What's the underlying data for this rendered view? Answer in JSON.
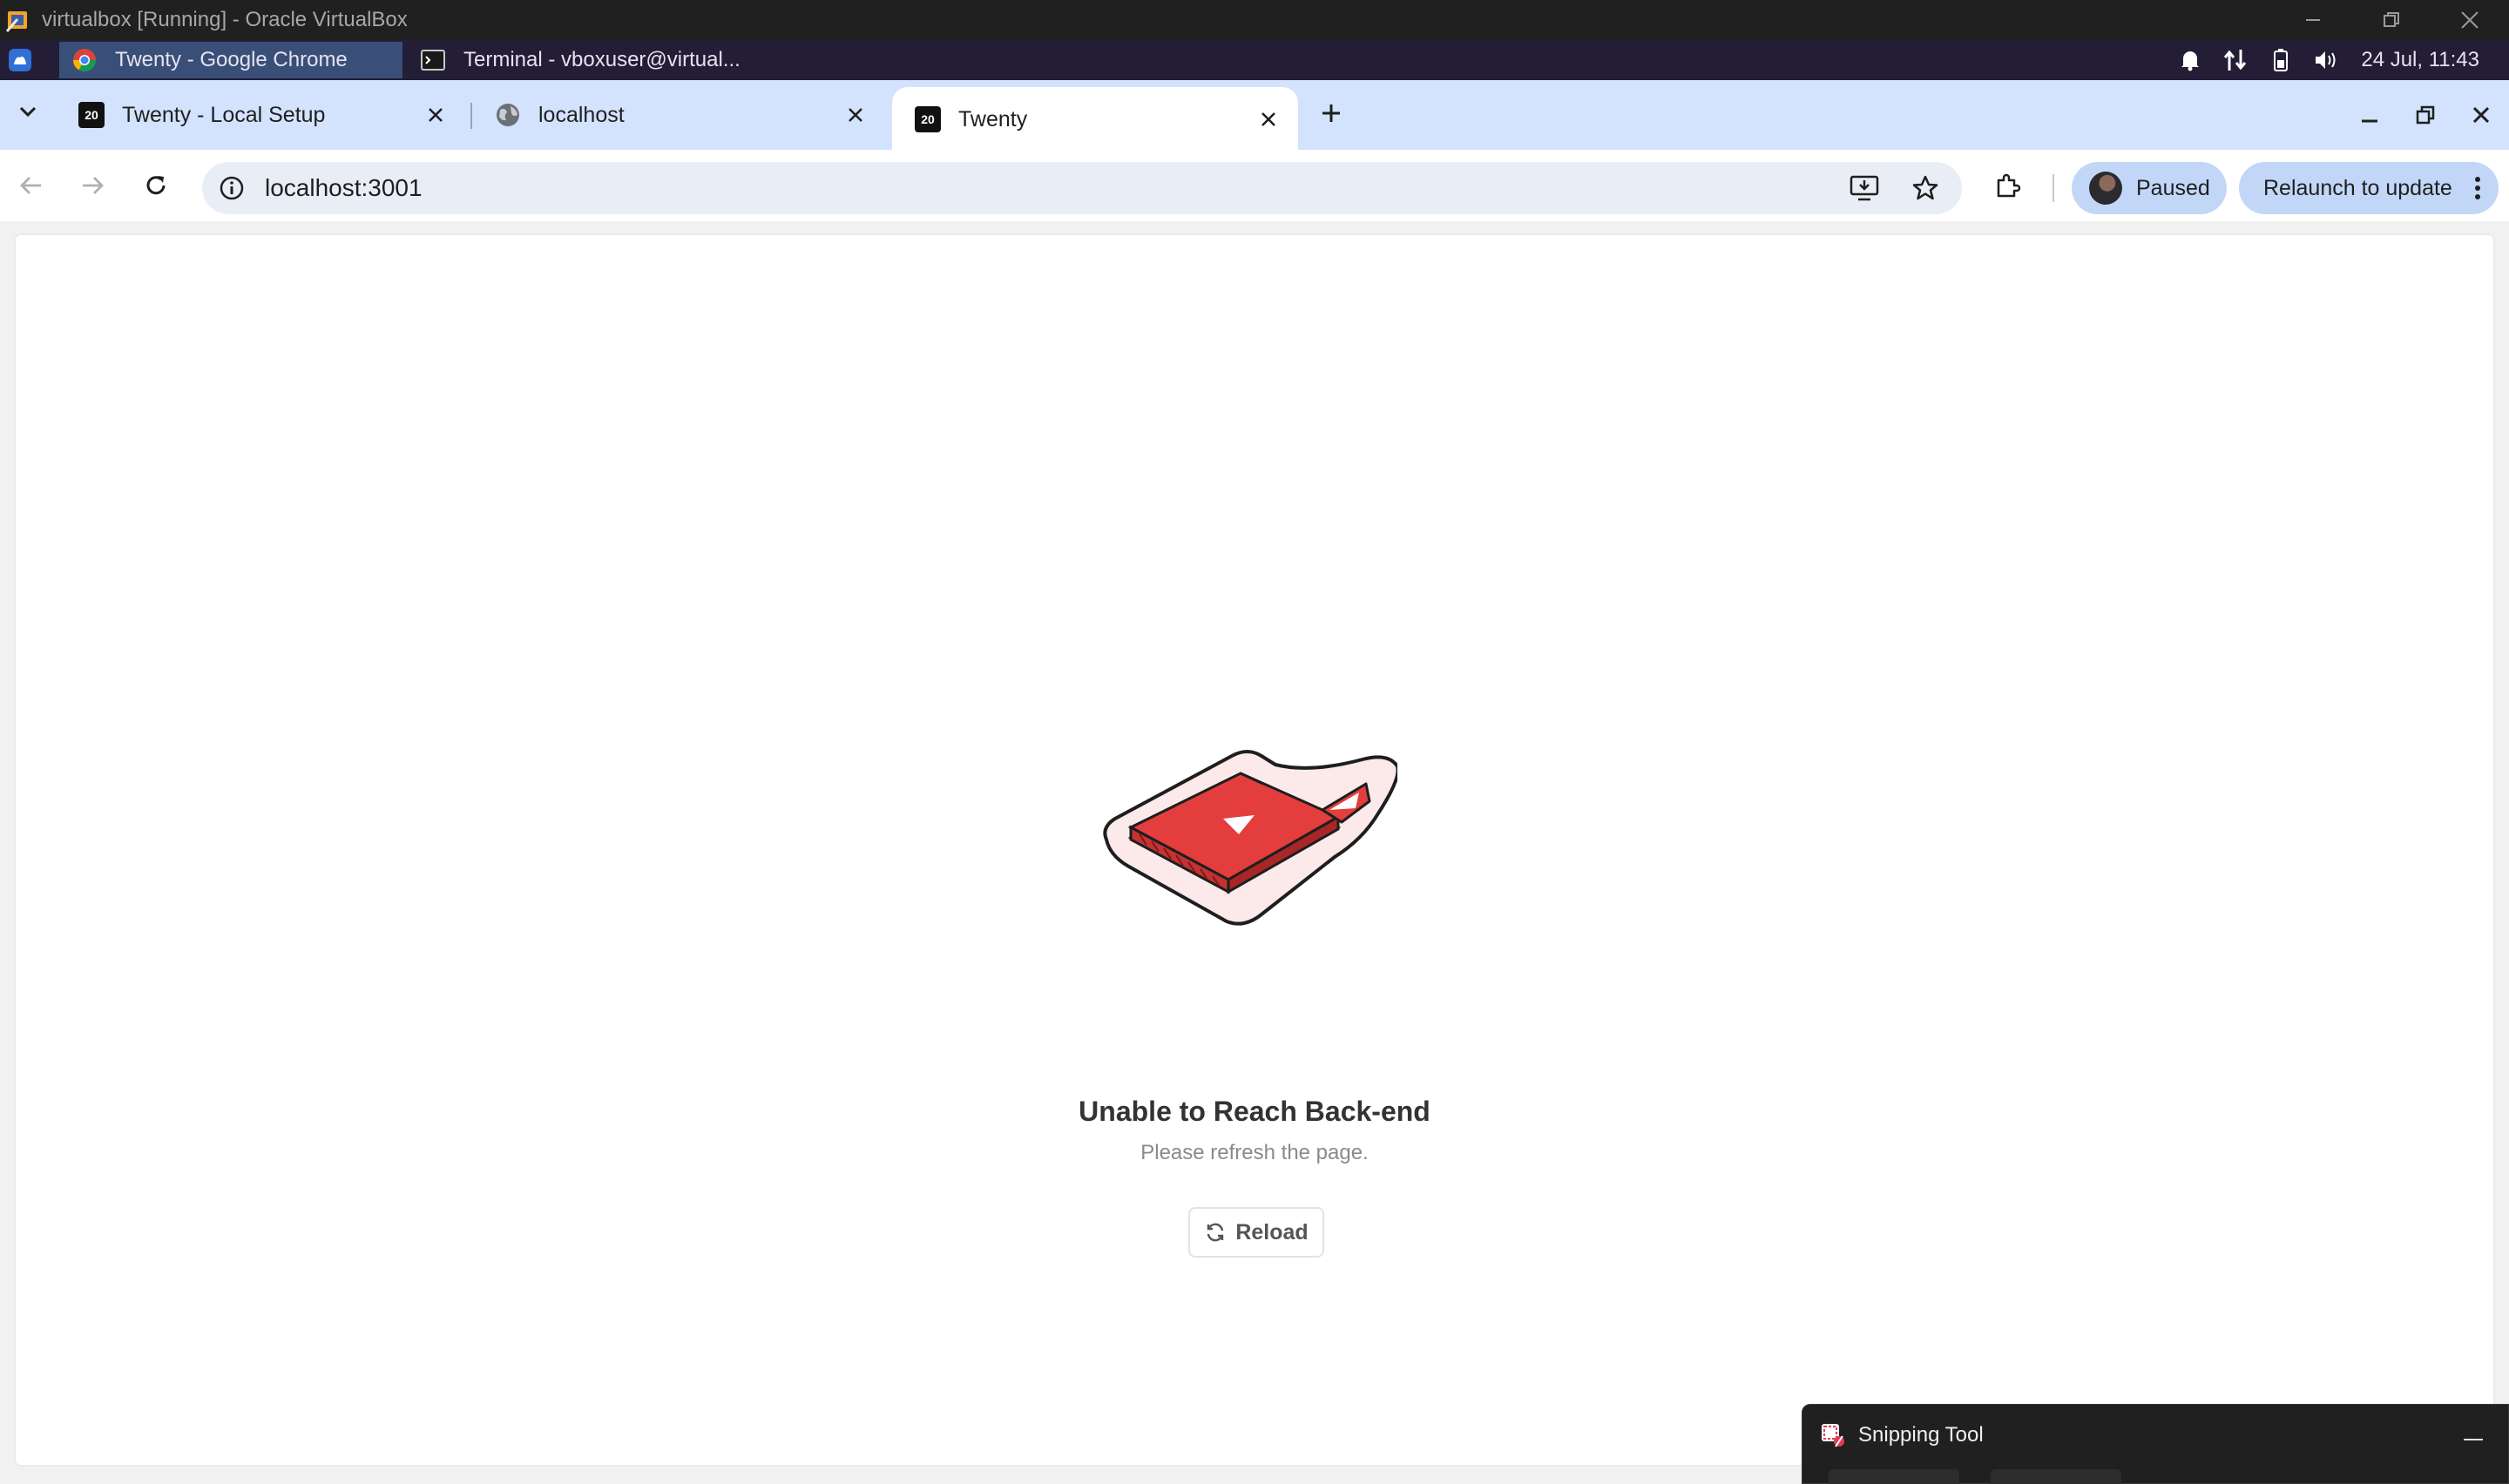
{
  "vbox": {
    "title": "virtualbox [Running] - Oracle VirtualBox"
  },
  "guest_taskbar": {
    "tasks": [
      {
        "label": "Twenty - Google Chrome",
        "active": true
      },
      {
        "label": "Terminal - vboxuser@virtual...",
        "active": false
      }
    ],
    "clock": "24 Jul, 11:43"
  },
  "chrome": {
    "tabs": [
      {
        "label": "Twenty - Local Setup",
        "favicon": "twenty-logo"
      },
      {
        "label": "localhost",
        "favicon": "globe-icon"
      },
      {
        "label": "Twenty",
        "favicon": "twenty-logo",
        "active": true
      }
    ],
    "favicon_text": "20",
    "address": "localhost:3001",
    "profile_label": "Paused",
    "relaunch_label": "Relaunch to update"
  },
  "page": {
    "error_title": "Unable to Reach Back-end",
    "error_subtitle": "Please refresh the page.",
    "reload_label": "Reload"
  },
  "snipping_tool": {
    "title": "Snipping Tool"
  },
  "colors": {
    "tabstrip": "#d3e3fd",
    "accent_red": "#e43d3d",
    "chip": "#c2d7f7"
  }
}
